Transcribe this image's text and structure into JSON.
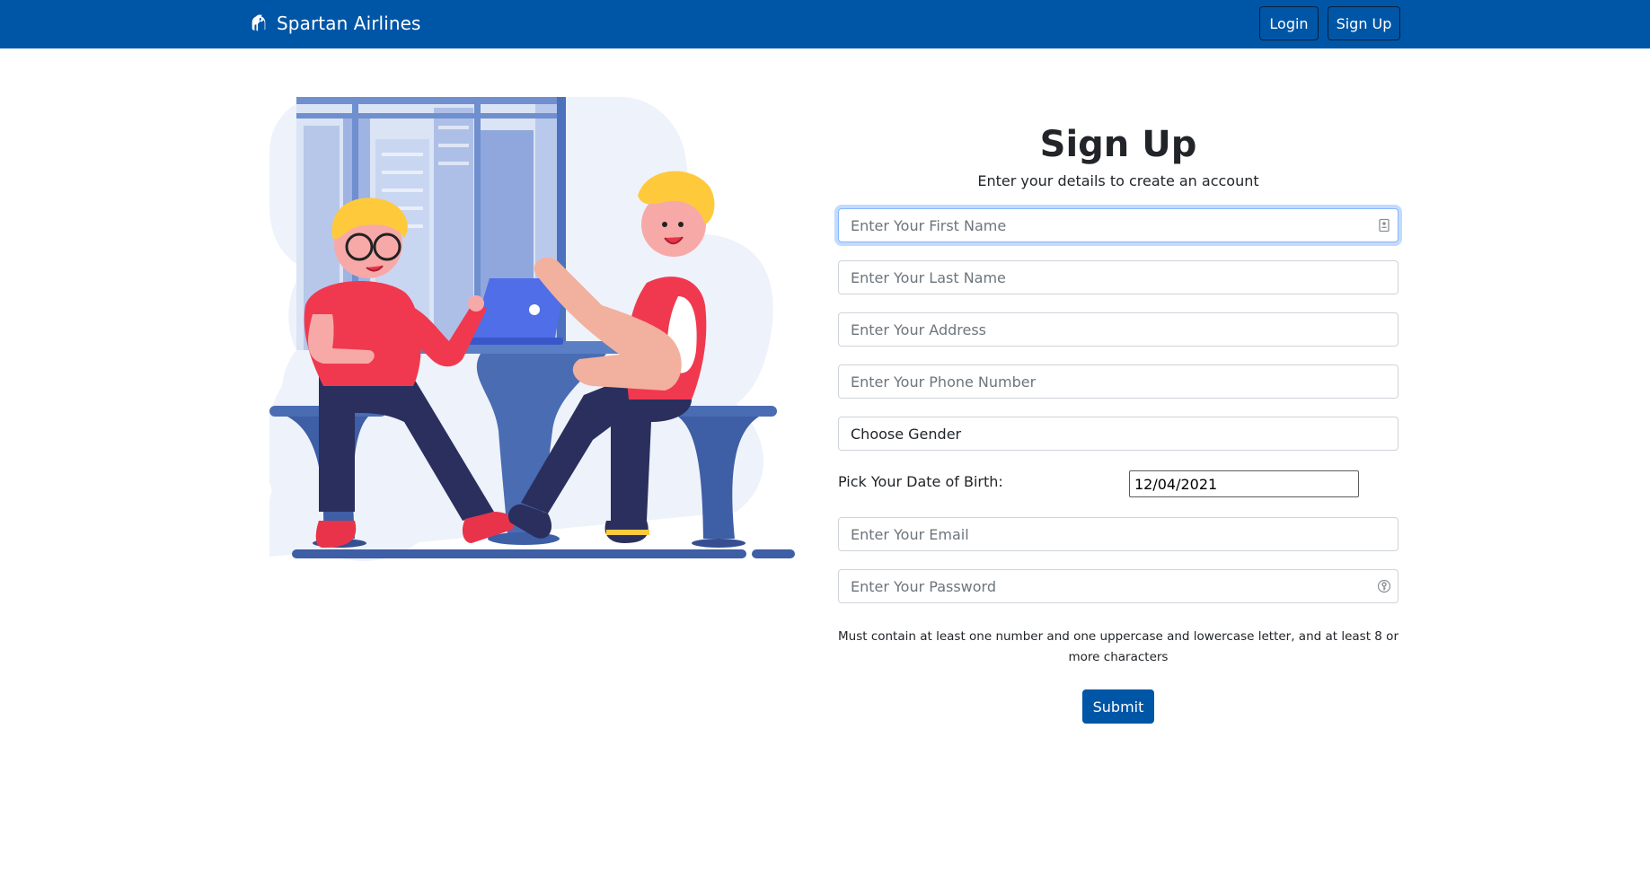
{
  "navbar": {
    "brand": "Spartan Airlines",
    "brand_icon": "spartan-helmet-icon",
    "login_label": "Login",
    "signup_label": "Sign Up",
    "background": "#0056a6"
  },
  "illustration": {
    "name": "two-people-at-table-illustration"
  },
  "form": {
    "title": "Sign Up",
    "subtitle": "Enter your details to create an account",
    "first_name_placeholder": "Enter Your First Name",
    "last_name_placeholder": "Enter Your Last Name",
    "address_placeholder": "Enter Your Address",
    "phone_placeholder": "Enter Your Phone Number",
    "gender_selected": "Choose Gender",
    "dob_label": "Pick Your Date of Birth:",
    "dob_value": "12/04/2021",
    "email_placeholder": "Enter Your Email",
    "password_placeholder": "Enter Your Password",
    "password_hint": "Must contain at least one number and one uppercase and lowercase letter, and at least 8 or more characters",
    "submit_label": "Submit",
    "first_name_icon": "contact-card-icon",
    "password_icon": "key-icon",
    "accent": "#0056a6"
  }
}
